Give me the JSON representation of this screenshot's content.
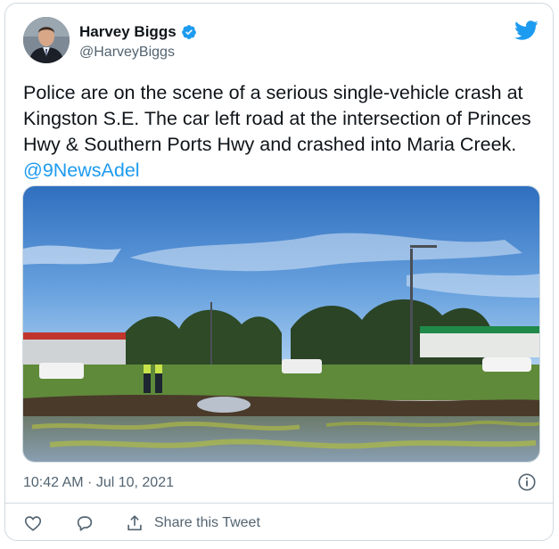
{
  "author": {
    "name": "Harvey Biggs",
    "handle": "@HarveyBiggs",
    "verified_icon": "verified-badge-icon",
    "avatar_icon": "profile-avatar"
  },
  "brand": {
    "icon": "twitter-bird-icon",
    "color": "#1d9bf0"
  },
  "tweet": {
    "text": "Police are on the scene of a serious single-vehicle crash at Kingston S.E. The car left road at the intersection of Princes Hwy & Southern Ports Hwy and crashed into Maria Creek. ",
    "mention": "@9NewsAdel",
    "timestamp": "10:42 AM · Jul 10, 2021"
  },
  "media": {
    "icon": "photo-crash-scene",
    "description_colors": {
      "sky": "#3f7fc9",
      "grass": "#5f8a3a",
      "water": "#5c6a52"
    }
  },
  "actions": {
    "like_icon": "heart-icon",
    "reply_icon": "reply-icon",
    "share_icon": "share-icon",
    "share_label": "Share this Tweet",
    "info_icon": "info-icon"
  },
  "colors": {
    "text": "#0f1419",
    "muted": "#536471",
    "border": "#cfd9de",
    "accent": "#1d9bf0"
  }
}
